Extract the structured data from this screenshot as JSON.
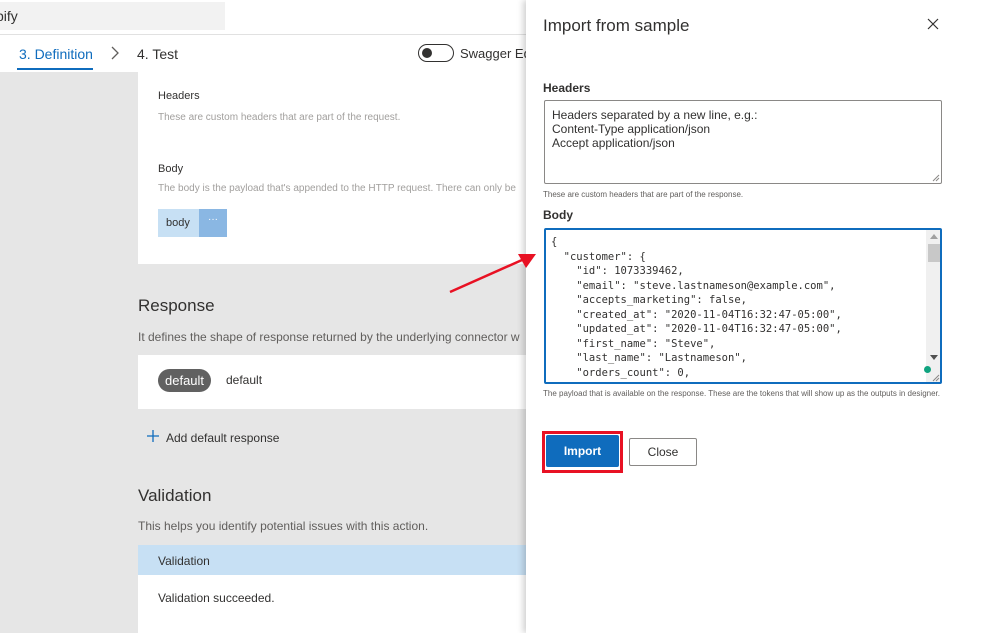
{
  "left_page": {
    "name_field_value": "pify",
    "breadcrumb": {
      "definition_tab": "3. Definition",
      "test_tab": "4. Test"
    },
    "swagger_toggle_label": "Swagger Edi",
    "request": {
      "headers_label": "Headers",
      "headers_desc": "These are custom headers that are part of the request.",
      "body_label": "Body",
      "body_desc": "The body is the payload that's appended to the HTTP request. There can only be",
      "body_chip_label": "body",
      "body_chip_more": "···"
    },
    "response": {
      "title": "Response",
      "desc": "It defines the shape of response returned by the underlying connector w",
      "default_pill": "default",
      "default_text": "default",
      "add_default_response": "Add default response"
    },
    "validation": {
      "title": "Validation",
      "desc": "This helps you identify potential issues with this action.",
      "header": "Validation",
      "status": "Validation succeeded."
    }
  },
  "panel": {
    "title": "Import from sample",
    "headers_label": "Headers",
    "headers_placeholder": "Headers separated by a new line, e.g.:\nContent-Type application/json\nAccept application/json",
    "headers_help": "These are custom headers that are part of the response.",
    "body_label": "Body",
    "body_value": "{\n  \"customer\": {\n    \"id\": 1073339462,\n    \"email\": \"steve.lastnameson@example.com\",\n    \"accepts_marketing\": false,\n    \"created_at\": \"2020-11-04T16:32:47-05:00\",\n    \"updated_at\": \"2020-11-04T16:32:47-05:00\",\n    \"first_name\": \"Steve\",\n    \"last_name\": \"Lastnameson\",\n    \"orders_count\": 0,",
    "body_help": "The payload that is available on the response. These are the tokens that will show up as the outputs in designer.",
    "import_button": "Import",
    "close_button": "Close"
  },
  "colors": {
    "accent": "#0f6cbd",
    "annotation_red": "#e81123",
    "highlight_blue": "#c7e0f4"
  },
  "icons": [
    "chevron-right-icon",
    "plus-icon",
    "close-icon",
    "resize-grip-icon",
    "annotation-arrow"
  ]
}
